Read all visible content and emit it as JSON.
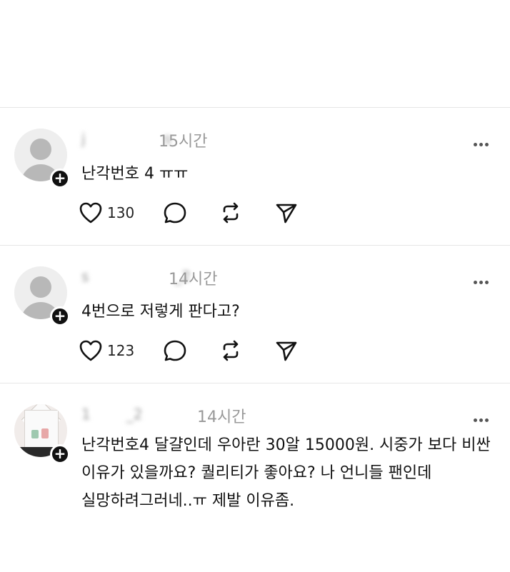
{
  "posts": [
    {
      "username": "j           s",
      "time": "15시간",
      "text": [
        "난각번호 4 ㅠㅠ"
      ],
      "likes": "130",
      "avatar": "default-avatar"
    },
    {
      "username": "s            _2",
      "time": "14시간",
      "text": [
        "4번으로 저렇게 판다고?"
      ],
      "likes": "123",
      "avatar": "default-avatar"
    },
    {
      "username": "1     _2     ",
      "time": "14시간",
      "text": [
        "난각번호4 달걀인데 우아란 30알 15000원. 시중가 보다 비싼",
        "이유가 있을까요? 퀄리티가 좋아요? 나 언니들 팬인데",
        "실망하려그러네..ㅠ 제발 이유좀."
      ],
      "avatar": "photo-avatar"
    }
  ],
  "icons": {
    "like": "heart-icon",
    "comment": "comment-icon",
    "repost": "repost-icon",
    "share": "send-icon",
    "more": "more-icon",
    "follow": "plus-icon"
  }
}
